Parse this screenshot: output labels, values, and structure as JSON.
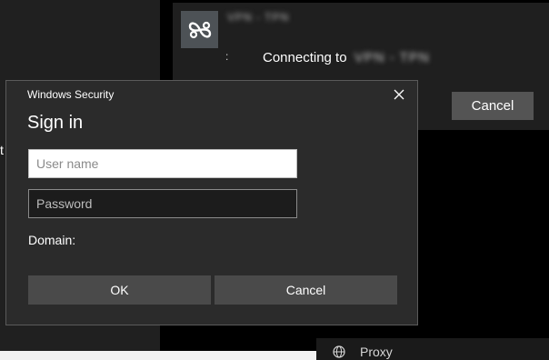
{
  "background": {
    "left_glyph": "t",
    "vpn_panel": {
      "connection_name": "VPN - TPN",
      "status_dot": ":",
      "status_text": "Connecting to",
      "status_target": "VPN - TPN",
      "cancel_label": "Cancel"
    },
    "proxy_label": "Proxy"
  },
  "dialog": {
    "title": "Windows Security",
    "heading": "Sign in",
    "username_placeholder": "User name",
    "username_value": "",
    "password_placeholder": "Password",
    "password_value": "",
    "domain_label": "Domain:",
    "ok_label": "OK",
    "cancel_label": "Cancel"
  },
  "colors": {
    "dialog_bg": "#2b2b2b",
    "button_bg": "#4a4a4a",
    "vpn_panel_bg": "#1f1f1f"
  },
  "icons": {
    "vpn_logo": "infinity-logo-icon",
    "close": "close-icon",
    "proxy": "globe-icon"
  }
}
